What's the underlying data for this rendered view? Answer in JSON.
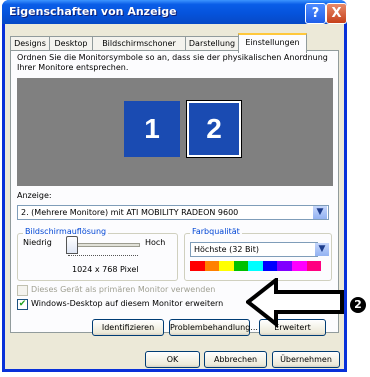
{
  "window": {
    "title": "Eigenschaften von Anzeige",
    "help_glyph": "?",
    "close_glyph": "X"
  },
  "tabs": [
    {
      "label": "Designs"
    },
    {
      "label": "Desktop"
    },
    {
      "label": "Bildschirmschoner"
    },
    {
      "label": "Darstellung"
    },
    {
      "label": "Einstellungen",
      "active": true
    }
  ],
  "settings": {
    "intro": "Ordnen Sie die Monitorsymbole so an, dass sie der physikalischen Anordnung Ihrer Monitore entsprechen.",
    "monitors": [
      "1",
      "2"
    ],
    "display_label": "Anzeige:",
    "display_value": "2. (Mehrere Monitore) mit ATI MOBILITY RADEON 9600",
    "resolution": {
      "title": "Bildschirmauflösung",
      "low": "Niedrig",
      "high": "Hoch",
      "value": "1024 x 768 Pixel",
      "slider_position": 0
    },
    "color": {
      "title": "Farbqualität",
      "value": "Höchste (32 Bit)",
      "bar_colors": [
        "#ff0000",
        "#ff8000",
        "#ffff00",
        "#00c000",
        "#00ffff",
        "#0000ff",
        "#8000ff",
        "#ff00ff",
        "#ff0080"
      ]
    },
    "checkbox_primary": {
      "label": "Dieses Gerät als primären Monitor verwenden",
      "checked": false,
      "enabled": false
    },
    "checkbox_extend": {
      "label": "Windows-Desktop auf diesem Monitor erweitern",
      "checked": true
    },
    "buttons": {
      "identify": "Identifizieren",
      "troubleshoot": "Problembehandlung...",
      "advanced": "Erweitert"
    }
  },
  "footer": {
    "ok": "OK",
    "cancel": "Abbrechen",
    "apply": "Übernehmen"
  },
  "annotation": {
    "marker": "2"
  },
  "icons": {
    "combo_arrow": "chevron-down-icon",
    "check": "checkmark-icon"
  },
  "colors": {
    "titlebar": "#0553dc",
    "client": "#ece9d8",
    "monitor_area": "#808080",
    "monitor": "#1a4bb2"
  }
}
